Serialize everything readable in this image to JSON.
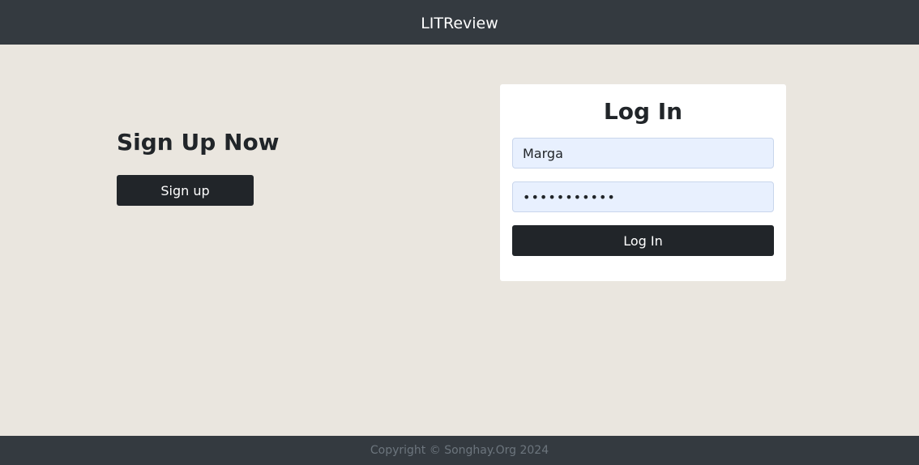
{
  "header": {
    "brand": "LITReview"
  },
  "signup": {
    "title": "Sign Up Now",
    "button_label": "Sign up"
  },
  "login": {
    "title": "Log In",
    "username_value": "Marga",
    "password_value": "•••••••••••",
    "button_label": "Log In"
  },
  "footer": {
    "copyright": "Copyright © Songhay.Org 2024"
  },
  "colors": {
    "header_bg": "#343a40",
    "page_bg": "#eae6df",
    "button_bg": "#212529",
    "input_autofill_bg": "#e8f0fe"
  }
}
